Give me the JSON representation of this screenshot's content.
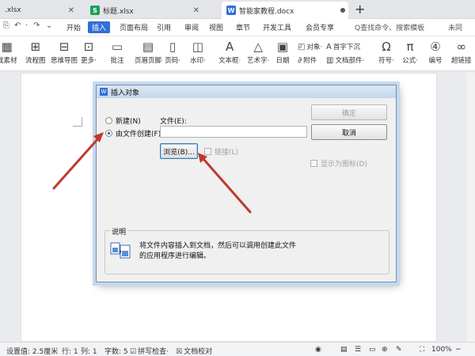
{
  "tabs": [
    {
      "label": ".xlsx",
      "icon": "spreadsheet-icon"
    },
    {
      "label": "标题.xlsx",
      "icon": "spreadsheet-icon",
      "icon_text": "S"
    },
    {
      "label": "智能家教程.docx",
      "icon": "word-doc-icon",
      "icon_text": "W",
      "active": true
    }
  ],
  "menu": {
    "items": [
      "开始",
      "插入",
      "页面布局",
      "引用",
      "审阅",
      "视图",
      "章节",
      "开发工具",
      "会员专享"
    ],
    "active": "插入",
    "search_placeholder": "Q查找命令、搜索模板",
    "right_label": "未同"
  },
  "ribbon": {
    "big": [
      {
        "label": "我素材"
      },
      {
        "label": "流程图"
      },
      {
        "label": "思维导图"
      },
      {
        "label": "更多·"
      },
      {
        "label": "批注"
      },
      {
        "label": "页眉页脚"
      },
      {
        "label": "页码·"
      },
      {
        "label": "水印·"
      },
      {
        "label": "文本框·"
      },
      {
        "label": "艺术字·"
      },
      {
        "label": "日期"
      },
      {
        "label": "符号·"
      },
      {
        "label": "公式·"
      },
      {
        "label": "编号"
      },
      {
        "label": "超链接"
      }
    ],
    "small": [
      {
        "label": "对象·"
      },
      {
        "label": "首字下沉"
      },
      {
        "label": "附件"
      },
      {
        "label": "文档部件·"
      }
    ]
  },
  "dialog": {
    "title": "插入对象",
    "radio_new": "新建(N)",
    "radio_from_file": "由文件创建(F)",
    "file_label": "文件(E):",
    "file_value": "",
    "ok_label": "确定",
    "cancel_label": "取消",
    "browse_label": "浏览(B)...",
    "link_label": "链接(L)",
    "show_icon_label": "显示为图标(D)",
    "desc_title": "说明",
    "desc_text": "将文件内容插入到文档，然后可以调用创建此文件的应用程序进行编辑。"
  },
  "status": {
    "margin": "设置值: 2.5厘米",
    "row": "行: 1",
    "col": "列: 1",
    "words": "字数: 5",
    "spell": "拼写检查·",
    "proof": "文档校对",
    "zoom": "100%"
  },
  "colors": {
    "accent": "#2f6fd7",
    "arrow": "#c0392b",
    "dialog_bg": "#f0f0f0"
  }
}
